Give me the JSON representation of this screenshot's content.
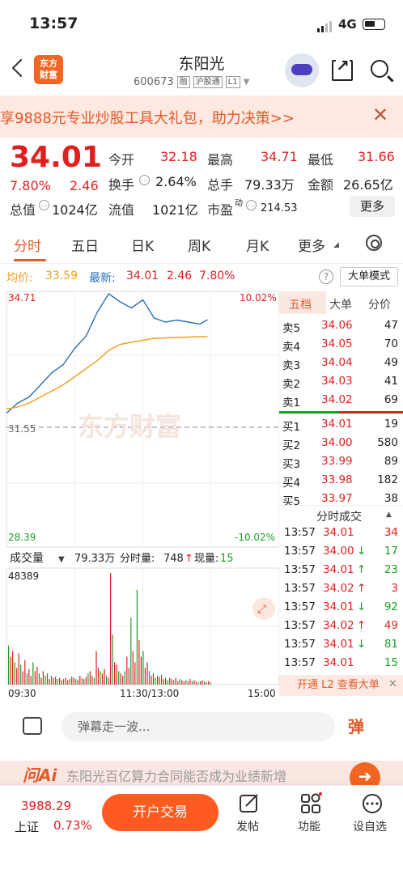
{
  "status_bar": {
    "time": "13:57",
    "network": "4G"
  },
  "header": {
    "logo_text_1": "东方",
    "logo_text_2": "财富",
    "stock_name": "东阳光",
    "stock_code": "600673",
    "tag_margin": "融",
    "tag_connect": "沪股通",
    "tag_level": "L1"
  },
  "banner": {
    "text": "享9888元专业炒股工具大礼包，助力决策>>"
  },
  "quote": {
    "price": "34.01",
    "change_pct": "7.80%",
    "change_amt": "2.46",
    "open_label": "今开",
    "open": "32.18",
    "high_label": "最高",
    "high": "34.71",
    "low_label": "最低",
    "low": "31.66",
    "turnover_label": "换手",
    "turnover": "2.64%",
    "volume_label": "总手",
    "volume": "79.33万",
    "amount_label": "金额",
    "amount": "26.65亿",
    "mktcap_label": "总值",
    "mktcap": "1024亿",
    "float_label": "流值",
    "float": "1021亿",
    "pe_label": "市盈",
    "pe_sup": "动",
    "pe": "214.53",
    "more_label": "更多"
  },
  "tabs": [
    "分时",
    "五日",
    "日K",
    "周K",
    "月K",
    "更多"
  ],
  "chart_header": {
    "avg_label": "均价:",
    "avg": "33.59",
    "latest_label": "最新:",
    "latest": "34.01",
    "latest_chg": "2.46",
    "latest_pct": "7.80%",
    "help": "?",
    "bigorder": "大单模式"
  },
  "chart_labels": {
    "y_high": "34.71",
    "y_pre": "31.55",
    "y_low": "28.39",
    "pct_high": "10.02%",
    "pct_low": "-10.02%",
    "watermark": "东方财富",
    "vol_title": "成交量",
    "vol_total": "79.33万",
    "vol_min_label": "分时量:",
    "vol_min": "748",
    "vol_now_label": "现量:",
    "vol_now": "15",
    "vol_max": "48389",
    "t_start": "09:30",
    "t_mid": "11:30/13:00",
    "t_end": "15:00"
  },
  "chart_data": {
    "type": "line",
    "title": "",
    "ylim": [
      28.39,
      34.71
    ],
    "prev_close": 31.55,
    "x": [
      "09:30",
      "09:40",
      "09:50",
      "10:00",
      "10:10",
      "10:20",
      "10:30",
      "10:40",
      "10:50",
      "11:00",
      "11:10",
      "11:20",
      "11:30",
      "13:10",
      "13:20",
      "13:30",
      "13:40",
      "13:50",
      "13:57"
    ],
    "series": [
      {
        "name": "最新",
        "values": [
          31.7,
          31.95,
          32.1,
          32.4,
          32.7,
          32.9,
          33.3,
          33.6,
          34.2,
          34.65,
          34.45,
          34.3,
          34.5,
          34.05,
          33.95,
          34.0,
          33.95,
          33.9,
          34.01
        ]
      },
      {
        "name": "均价",
        "values": [
          31.8,
          31.85,
          31.95,
          32.1,
          32.25,
          32.4,
          32.6,
          32.8,
          33.0,
          33.25,
          33.4,
          33.45,
          33.5,
          33.55,
          33.56,
          33.57,
          33.58,
          33.59,
          33.59
        ]
      }
    ]
  },
  "book": {
    "tabs": [
      "五档",
      "大单",
      "分价"
    ],
    "asks": [
      {
        "label": "卖5",
        "price": "34.06",
        "vol": "47"
      },
      {
        "label": "卖4",
        "price": "34.05",
        "vol": "70"
      },
      {
        "label": "卖3",
        "price": "34.04",
        "vol": "49"
      },
      {
        "label": "卖2",
        "price": "34.03",
        "vol": "41"
      },
      {
        "label": "卖1",
        "price": "34.02",
        "vol": "69"
      }
    ],
    "bids": [
      {
        "label": "买1",
        "price": "34.01",
        "vol": "19"
      },
      {
        "label": "买2",
        "price": "34.00",
        "vol": "580"
      },
      {
        "label": "买3",
        "price": "33.99",
        "vol": "89"
      },
      {
        "label": "买4",
        "price": "33.98",
        "vol": "182"
      },
      {
        "label": "买5",
        "price": "33.97",
        "vol": "38"
      }
    ],
    "ticks_title": "分时成交",
    "ticks": [
      {
        "time": "13:57",
        "price": "34.01",
        "arrow": "",
        "vol": "34",
        "color": "red"
      },
      {
        "time": "13:57",
        "price": "34.00",
        "arrow": "↓",
        "vol": "17",
        "color": "green"
      },
      {
        "time": "13:57",
        "price": "34.01",
        "arrow": "↑",
        "vol": "23",
        "color": "green"
      },
      {
        "time": "13:57",
        "price": "34.02",
        "arrow": "↑",
        "vol": "3",
        "color": "red"
      },
      {
        "time": "13:57",
        "price": "34.01",
        "arrow": "↓",
        "vol": "92",
        "color": "green"
      },
      {
        "time": "13:57",
        "price": "34.02",
        "arrow": "↑",
        "vol": "49",
        "color": "red"
      },
      {
        "time": "13:57",
        "price": "34.01",
        "arrow": "↓",
        "vol": "81",
        "color": "green"
      },
      {
        "time": "13:57",
        "price": "34.01",
        "arrow": "",
        "vol": "15",
        "color": "green"
      }
    ],
    "l2_text": "开通 L2 查看大单"
  },
  "danmu": {
    "placeholder": "弹幕走一波...",
    "button": "弹"
  },
  "ai_strip": {
    "label": "问Ai",
    "text": "东阳光百亿算力合同能否成为业绩新增"
  },
  "bottom": {
    "index_value": "3988.29",
    "index_name": "上证",
    "index_pct": "0.73%",
    "trade_label": "开户交易",
    "post_label": "发帖",
    "func_label": "功能",
    "settings_label": "设自选"
  },
  "colors": {
    "accent": "#e05a2a",
    "up": "#e02020",
    "down": "#1a9e2a",
    "price_line": "#2c6fb7",
    "avg_line": "#f0a020"
  }
}
